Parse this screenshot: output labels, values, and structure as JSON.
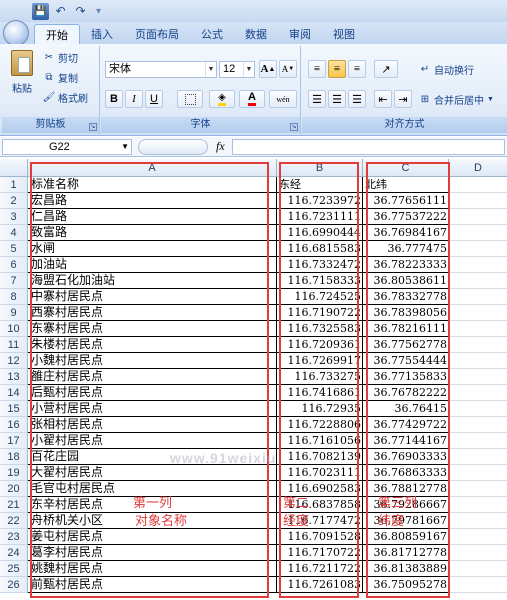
{
  "quick_access": {
    "save": "💾",
    "undo": "↶",
    "redo": "↷",
    "customize": "▾"
  },
  "tabs": [
    "开始",
    "插入",
    "页面布局",
    "公式",
    "数据",
    "审阅",
    "视图"
  ],
  "ribbon": {
    "clipboard": {
      "label": "剪贴板",
      "paste": "粘贴",
      "cut": "剪切",
      "copy": "复制",
      "format_painter": "格式刷"
    },
    "font": {
      "label": "字体",
      "name": "宋体",
      "size": "12",
      "bold": "B",
      "italic": "I",
      "underline": "U",
      "grow": "A",
      "shrink": "A",
      "phonetic": "wén"
    },
    "alignment": {
      "label": "对齐方式",
      "wrap_text": "自动换行",
      "merge_center": "合并后居中"
    }
  },
  "formula_bar": {
    "name_box": "G22",
    "fx": "fx",
    "value": ""
  },
  "columns": [
    "A",
    "B",
    "C",
    "D"
  ],
  "header_row": {
    "a": "标准名称",
    "b": "东经",
    "c": "北纬"
  },
  "rows": [
    {
      "n": "2",
      "a": "宏昌路",
      "b": "116.7233972",
      "c": "36.77656111"
    },
    {
      "n": "3",
      "a": "仁昌路",
      "b": "116.7231111",
      "c": "36.77537222"
    },
    {
      "n": "4",
      "a": "致富路",
      "b": "116.6990444",
      "c": "36.76984167"
    },
    {
      "n": "5",
      "a": "水闸",
      "b": "116.6815583",
      "c": "36.777475"
    },
    {
      "n": "6",
      "a": "加油站",
      "b": "116.7332472",
      "c": "36.78223333"
    },
    {
      "n": "7",
      "a": "海盟石化加油站",
      "b": "116.7158333",
      "c": "36.80538611"
    },
    {
      "n": "8",
      "a": "中寨村居民点",
      "b": "116.724525",
      "c": "36.78332778"
    },
    {
      "n": "9",
      "a": "西寨村居民点",
      "b": "116.7190722",
      "c": "36.78398056"
    },
    {
      "n": "10",
      "a": "东寨村居民点",
      "b": "116.7325583",
      "c": "36.78216111"
    },
    {
      "n": "11",
      "a": "朱楼村居民点",
      "b": "116.7209361",
      "c": "36.77562778"
    },
    {
      "n": "12",
      "a": "小魏村居民点",
      "b": "116.7269917",
      "c": "36.77554444"
    },
    {
      "n": "13",
      "a": "雒庄村居民点",
      "b": "116.733275",
      "c": "36.77135833"
    },
    {
      "n": "14",
      "a": "后甄村居民点",
      "b": "116.7416861",
      "c": "36.76782222"
    },
    {
      "n": "15",
      "a": "小营村居民点",
      "b": "116.72935",
      "c": "36.76415"
    },
    {
      "n": "16",
      "a": "张相村居民点",
      "b": "116.7228806",
      "c": "36.77429722"
    },
    {
      "n": "17",
      "a": "小翟村居民点",
      "b": "116.7161056",
      "c": "36.77144167"
    },
    {
      "n": "18",
      "a": "百花庄园",
      "b": "116.7082139",
      "c": "36.76903333"
    },
    {
      "n": "19",
      "a": "大翟村居民点",
      "b": "116.7023111",
      "c": "36.76863333"
    },
    {
      "n": "20",
      "a": "毛官屯村居民点",
      "b": "116.6902583",
      "c": "36.78812778"
    },
    {
      "n": "21",
      "a": "东辛村居民点",
      "b": "116.6837858",
      "c": "36.79286667"
    },
    {
      "n": "22",
      "a": "舟桥机关小区",
      "b": "116.7177472",
      "c": "36.79781667"
    },
    {
      "n": "23",
      "a": "姜屯村居民点",
      "b": "116.7091528",
      "c": "36.80859167"
    },
    {
      "n": "24",
      "a": "葛李村居民点",
      "b": "116.7170722",
      "c": "36.81712778"
    },
    {
      "n": "25",
      "a": "姚魏村居民点",
      "b": "116.7211722",
      "c": "36.81383889"
    },
    {
      "n": "26",
      "a": "前甄村居民点",
      "b": "116.7261083",
      "c": "36.75095278"
    }
  ],
  "annotations": {
    "col_a_line1": "第一列",
    "col_a_line2": "对象名称",
    "col_b_line1": "第二",
    "col_b_line2": "经度",
    "col_c_line1": "第三列",
    "col_c_line2": "纬度"
  },
  "watermark": "www.91weixiu",
  "colors": {
    "annotation_red": "#e23b3b",
    "ribbon_blue": "#15428b"
  }
}
